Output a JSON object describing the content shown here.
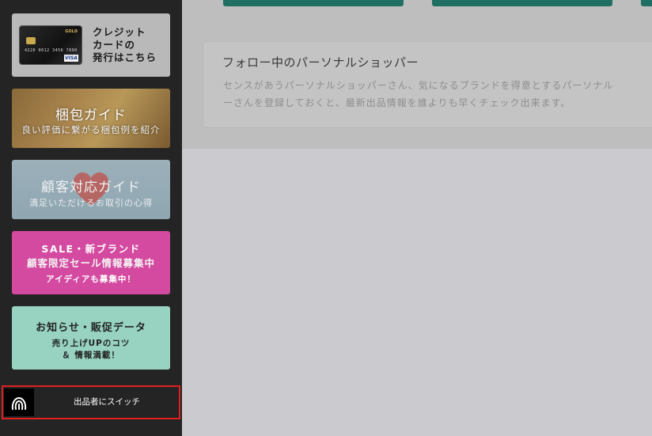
{
  "sidebar": {
    "card_banner": {
      "text": "クレジット\nカードの\n発行はこちら",
      "card_number": "4220 0012 3456 7890",
      "card_gold": "GOLD",
      "card_brand": "VISA"
    },
    "packing_banner": {
      "title": "梱包ガイド",
      "subtitle": "良い評価に繋がる梱包例を紹介"
    },
    "customer_banner": {
      "title": "顧客対応ガイド",
      "subtitle": "満足いただけるお取引の心得"
    },
    "sale_banner": {
      "line1": "SALE・新ブランド",
      "line2": "顧客限定セール情報募集中",
      "line3": "アイディアも募集中！"
    },
    "news_banner": {
      "title": "お知らせ・販促データ",
      "subtitle": "売り上げUPのコツ\n＆ 情報満載！"
    },
    "switch": {
      "label": "出品者にスイッチ",
      "icon": "fingerprint-icon"
    }
  },
  "main": {
    "follow": {
      "title": "フォロー中のパーソナルショッパー",
      "description": "センスがあうパーソナルショッパーさん、気になるブランドを得意とするパーソナル\nーさんを登録しておくと、最新出品情報を誰よりも早くチェック出来ます。"
    }
  },
  "colors": {
    "switch_border": "#e02020",
    "button_green": "#1f6f63",
    "sale_pink": "#d44aa0",
    "news_mint": "#97d3c0"
  }
}
